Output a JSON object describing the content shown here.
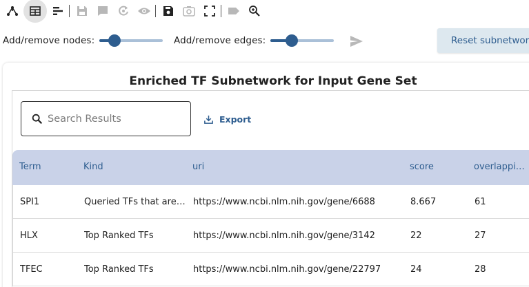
{
  "toolbar": {
    "icons": [
      "network-icon",
      "table-icon",
      "bar-chart-icon",
      "save-icon",
      "comment-icon",
      "refresh-icon",
      "eye-icon",
      "save-icon",
      "camera-icon",
      "fullscreen-icon",
      "label-icon",
      "zoom-icon"
    ]
  },
  "sliders": {
    "nodes_label": "Add/remove nodes:",
    "nodes_value": 0.24,
    "edges_label": "Add/remove edges:",
    "edges_value": 0.34,
    "reset_label": "Reset subnetwork"
  },
  "card": {
    "title": "Enriched TF Subnetwork for Input Gene Set",
    "search_placeholder": "Search Results",
    "export_label": "Export"
  },
  "table": {
    "columns": [
      "Term",
      "Kind",
      "uri",
      "score",
      "overlapping"
    ],
    "rows": [
      [
        "SPI1",
        "Queried TFs that are also Top Ranked",
        "https://www.ncbi.nlm.nih.gov/gene/6688",
        "8.667",
        "61"
      ],
      [
        "HLX",
        "Top Ranked TFs",
        "https://www.ncbi.nlm.nih.gov/gene/3142",
        "22",
        "27"
      ],
      [
        "TFEC",
        "Top Ranked TFs",
        "https://www.ncbi.nlm.nih.gov/gene/22797",
        "24",
        "28"
      ]
    ]
  },
  "colors": {
    "accent": "#2e5d8f",
    "header_bg": "#c9d2e8",
    "reset_bg": "#dde8ef"
  }
}
